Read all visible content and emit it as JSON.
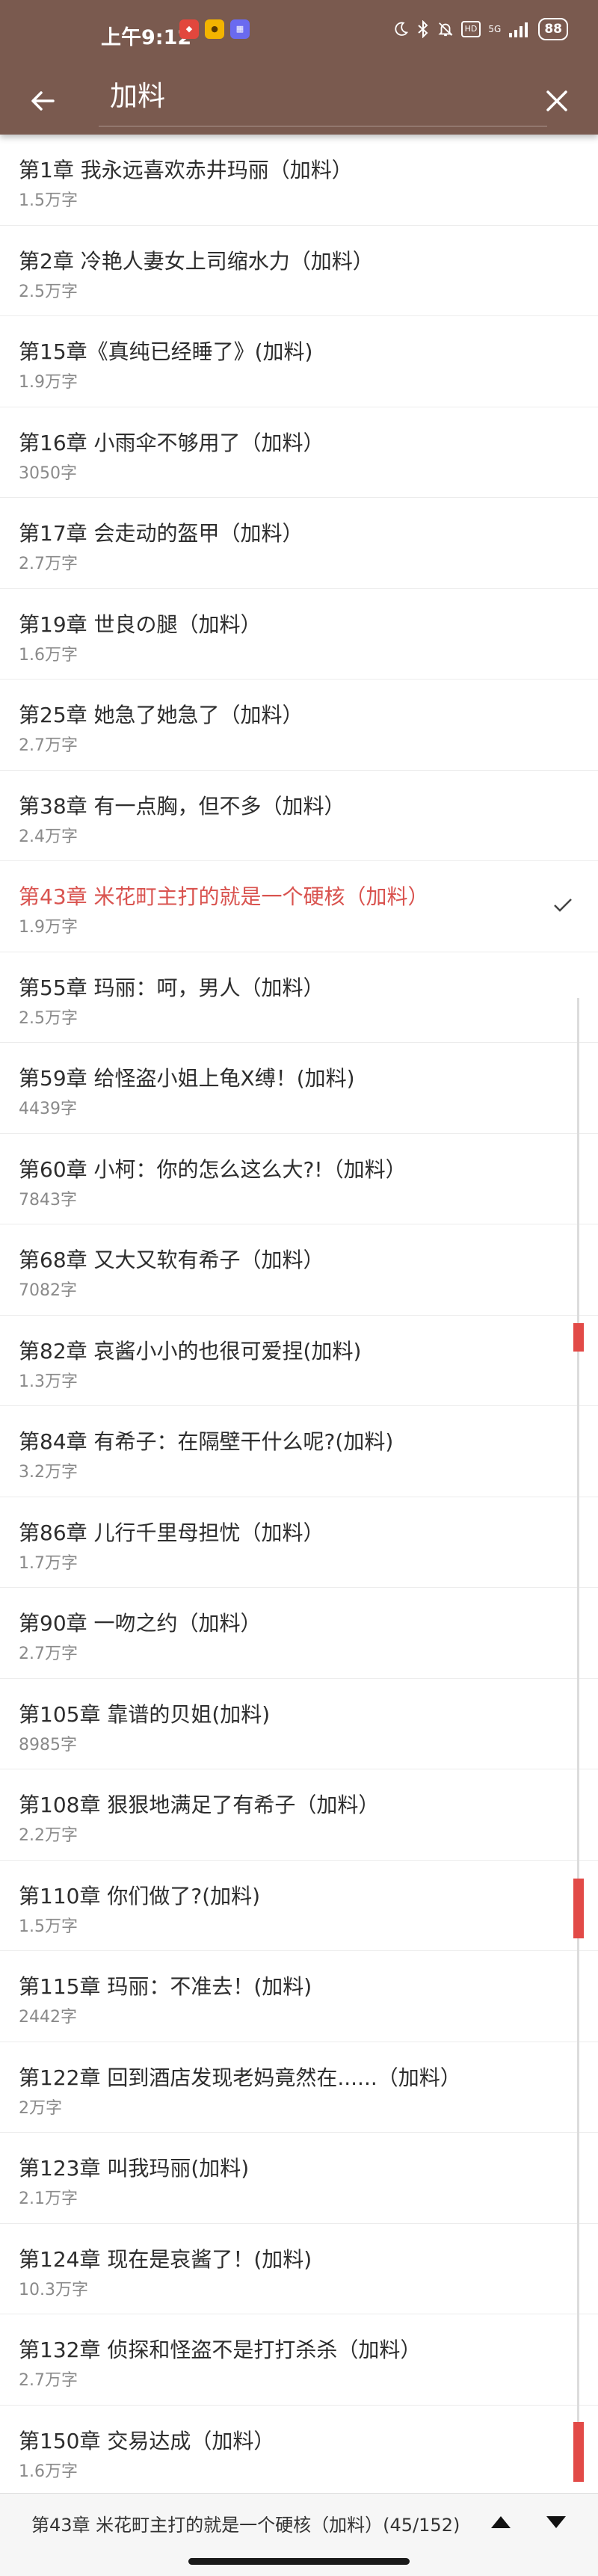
{
  "status_bar": {
    "time": "上午9:12",
    "notification_icons": [
      "app-a-icon",
      "app-b-icon",
      "app-c-icon"
    ],
    "hd_badge": "HD",
    "network": "5G",
    "battery": "88"
  },
  "toolbar": {
    "title": "加料",
    "back_icon": "arrow-left-icon",
    "close_icon": "close-icon"
  },
  "chapters": [
    {
      "title": "第1章 我永远喜欢赤井玛丽（加料）",
      "words": "1.5万字"
    },
    {
      "title": "第2章 冷艳人妻女上司缩水力（加料）",
      "words": "2.5万字"
    },
    {
      "title": "第15章《真纯已经睡了》(加料)",
      "words": "1.9万字"
    },
    {
      "title": "第16章 小雨伞不够用了（加料）",
      "words": "3050字"
    },
    {
      "title": "第17章 会走动的盔甲（加料）",
      "words": "2.7万字"
    },
    {
      "title": "第19章 世良の腿（加料）",
      "words": "1.6万字"
    },
    {
      "title": "第25章 她急了她急了（加料）",
      "words": "2.7万字"
    },
    {
      "title": "第38章 有一点胸，但不多（加料）",
      "words": "2.4万字"
    },
    {
      "title": "第43章 米花町主打的就是一个硬核（加料）",
      "words": "1.9万字",
      "current": true
    },
    {
      "title": "第55章 玛丽：呵，男人（加料）",
      "words": "2.5万字"
    },
    {
      "title": "第59章 给怪盗小姐上龟X缚！(加料)",
      "words": "4439字"
    },
    {
      "title": "第60章 小柯：你的怎么这么大?!（加料）",
      "words": "7843字"
    },
    {
      "title": "第68章 又大又软有希子（加料）",
      "words": "7082字"
    },
    {
      "title": "第82章 哀酱小小的也很可爱捏(加料)",
      "words": "1.3万字"
    },
    {
      "title": "第84章 有希子：在隔壁干什么呢?(加料)",
      "words": "3.2万字"
    },
    {
      "title": "第86章 儿行千里母担忧（加料）",
      "words": "1.7万字"
    },
    {
      "title": "第90章 一吻之约（加料）",
      "words": "2.7万字"
    },
    {
      "title": "第105章 靠谱的贝姐(加料)",
      "words": "8985字"
    },
    {
      "title": "第108章 狠狠地满足了有希子（加料）",
      "words": "2.2万字"
    },
    {
      "title": "第110章 你们做了?(加料)",
      "words": "1.5万字"
    },
    {
      "title": "第115章 玛丽：不准去！(加料)",
      "words": "2442字"
    },
    {
      "title": "第122章 回到酒店发现老妈竟然在......（加料）",
      "words": "2万字"
    },
    {
      "title": "第123章 叫我玛丽(加料)",
      "words": "2.1万字"
    },
    {
      "title": "第124章 现在是哀酱了！(加料)",
      "words": "10.3万字"
    },
    {
      "title": "第132章 侦探和怪盗不是打打杀杀（加料）",
      "words": "2.7万字"
    },
    {
      "title": "第150章 交易达成（加料）",
      "words": "1.6万字"
    }
  ],
  "current_check_icon": "check-icon",
  "colors": {
    "header": "#7a5a4f",
    "accent": "#d9534f",
    "scroll_mark": "#e24a47"
  },
  "bottom_bar": {
    "progress": "第43章 米花町主打的就是一个硬核（加料）(45/152)",
    "prev_icon": "triangle-up-icon",
    "next_icon": "triangle-down-icon"
  }
}
